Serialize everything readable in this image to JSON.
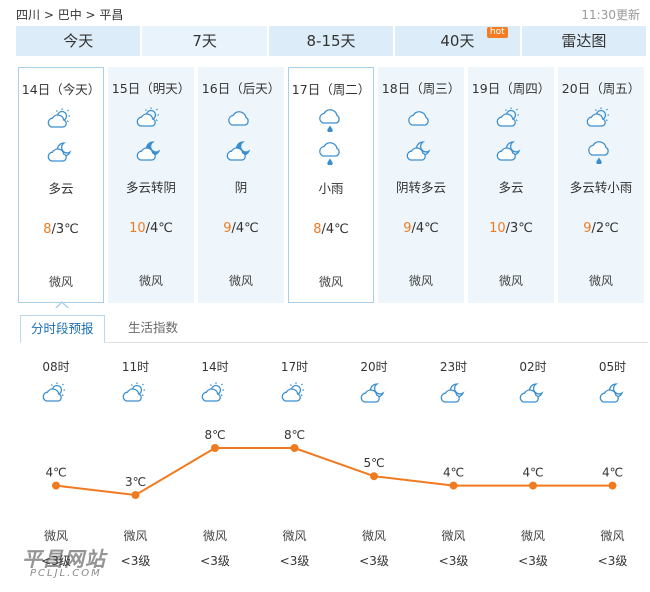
{
  "breadcrumb": {
    "province": "四川",
    "sep1": " > ",
    "city": "巴中",
    "sep2": " > ",
    "county": "平昌"
  },
  "update_time": "11:30更新",
  "tabs": [
    {
      "label": "今天"
    },
    {
      "label": "7天"
    },
    {
      "label": "8-15天"
    },
    {
      "label": "40天",
      "badge": "hot"
    },
    {
      "label": "雷达图"
    }
  ],
  "days": [
    {
      "date": "14日（今天）",
      "icon_day": "partly-cloudy-sun-icon",
      "icon_night": "partly-cloudy-moon-icon",
      "desc": "多云",
      "high": "8",
      "low": "/3℃",
      "wind": "微风"
    },
    {
      "date": "15日（明天）",
      "icon_day": "partly-cloudy-sun-icon",
      "icon_night": "overcast-moon-icon",
      "desc": "多云转阴",
      "high": "10",
      "low": "/4℃",
      "wind": "微风"
    },
    {
      "date": "16日（后天）",
      "icon_day": "cloud-icon",
      "icon_night": "overcast-moon-icon",
      "desc": "阴",
      "high": "9",
      "low": "/4℃",
      "wind": "微风"
    },
    {
      "date": "17日（周二）",
      "icon_day": "light-rain-icon",
      "icon_night": "light-rain-icon",
      "desc": "小雨",
      "high": "8",
      "low": "/4℃",
      "wind": "微风"
    },
    {
      "date": "18日（周三）",
      "icon_day": "cloud-icon",
      "icon_night": "partly-cloudy-moon-icon",
      "desc": "阴转多云",
      "high": "9",
      "low": "/4℃",
      "wind": "微风"
    },
    {
      "date": "19日（周四）",
      "icon_day": "partly-cloudy-sun-icon",
      "icon_night": "partly-cloudy-moon-icon",
      "desc": "多云",
      "high": "10",
      "low": "/3℃",
      "wind": "微风"
    },
    {
      "date": "20日（周五）",
      "icon_day": "partly-cloudy-sun-icon",
      "icon_night": "light-rain-icon",
      "desc": "多云转小雨",
      "high": "9",
      "low": "/2℃",
      "wind": "微风"
    }
  ],
  "subtabs": {
    "active": "分时段预报",
    "other": "生活指数"
  },
  "hourly": [
    {
      "time": "08时",
      "icon": "partly-cloudy-sun-icon",
      "temp": 4,
      "temp_label": "4℃",
      "wind": "微风",
      "level": "<3级"
    },
    {
      "time": "11时",
      "icon": "partly-cloudy-sun-icon",
      "temp": 3,
      "temp_label": "3℃",
      "wind": "微风",
      "level": "<3级"
    },
    {
      "time": "14时",
      "icon": "partly-cloudy-sun-icon",
      "temp": 8,
      "temp_label": "8℃",
      "wind": "微风",
      "level": "<3级"
    },
    {
      "time": "17时",
      "icon": "partly-cloudy-sun-icon",
      "temp": 8,
      "temp_label": "8℃",
      "wind": "微风",
      "level": "<3级"
    },
    {
      "time": "20时",
      "icon": "partly-cloudy-moon-icon",
      "temp": 5,
      "temp_label": "5℃",
      "wind": "微风",
      "level": "<3级"
    },
    {
      "time": "23时",
      "icon": "partly-cloudy-moon-icon",
      "temp": 4,
      "temp_label": "4℃",
      "wind": "微风",
      "level": "<3级"
    },
    {
      "time": "02时",
      "icon": "partly-cloudy-moon-icon",
      "temp": 4,
      "temp_label": "4℃",
      "wind": "微风",
      "level": "<3级"
    },
    {
      "time": "05时",
      "icon": "partly-cloudy-moon-icon",
      "temp": 4,
      "temp_label": "4℃",
      "wind": "微风",
      "level": "<3级"
    }
  ],
  "colors": {
    "accent": "#f07a1f",
    "tab_bg": "#dcedf9",
    "day_bg": "#eef6fb",
    "border": "#a9cfe9",
    "link": "#1a6eb4"
  },
  "watermark": {
    "cn": "平昌网站",
    "en": "PCLJL.COM"
  }
}
